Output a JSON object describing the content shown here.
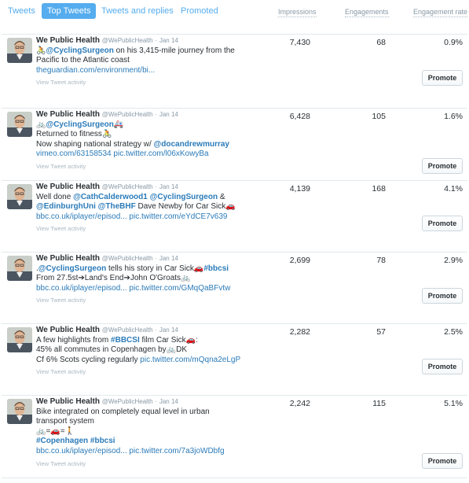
{
  "tabs": [
    {
      "label": "Tweets",
      "active": false
    },
    {
      "label": "Top Tweets",
      "active": true
    },
    {
      "label": "Tweets and replies",
      "active": false
    },
    {
      "label": "Promoted",
      "active": false
    }
  ],
  "columns": {
    "impressions": "Impressions",
    "engagements": "Engagements",
    "engagement_rate": "Engagement rate"
  },
  "activity_label": "View Tweet activity",
  "promote_label": "Promote",
  "tweets": [
    {
      "name": "We Public Health",
      "handle": "@WePublicHealth",
      "sep": "·",
      "date": "Jan 14",
      "lines": [
        [
          {
            "t": "🚴",
            "k": "text"
          },
          {
            "t": "@CyclingSurgeon",
            "k": "mention"
          },
          {
            "t": " on his 3,415-mile journey from the",
            "k": "text"
          }
        ],
        [
          {
            "t": "Pacific to the Atlantic coast",
            "k": "text"
          }
        ],
        [
          {
            "t": "theguardian.com/environment/bi...",
            "k": "link"
          }
        ]
      ],
      "impressions": "7,430",
      "engagements": "68",
      "engagement_rate": "0.9%"
    },
    {
      "name": "We Public Health",
      "handle": "@WePublicHealth",
      "sep": "·",
      "date": "Jan 14",
      "lines": [
        [
          {
            "t": "🚲",
            "k": "text"
          },
          {
            "t": "@CyclingSurgeon",
            "k": "mention"
          },
          {
            "t": "🚑",
            "k": "text"
          }
        ],
        [
          {
            "t": "Returned to fitness",
            "k": "text"
          },
          {
            "t": "🚴",
            "k": "text"
          }
        ],
        [
          {
            "t": "Now shaping national strategy w/ ",
            "k": "text"
          },
          {
            "t": "@docandrewmurray",
            "k": "mention"
          }
        ],
        [
          {
            "t": "vimeo.com/63158534",
            "k": "link"
          },
          {
            "t": " ",
            "k": "text"
          },
          {
            "t": "pic.twitter.com/l06xKowyBa",
            "k": "link"
          }
        ]
      ],
      "impressions": "6,428",
      "engagements": "105",
      "engagement_rate": "1.6%"
    },
    {
      "name": "We Public Health",
      "handle": "@WePublicHealth",
      "sep": "·",
      "date": "Jan 14",
      "lines": [
        [
          {
            "t": "Well done ",
            "k": "text"
          },
          {
            "t": "@CathCalderwood1",
            "k": "mention"
          },
          {
            "t": " ",
            "k": "text"
          },
          {
            "t": "@CyclingSurgeon",
            "k": "mention"
          },
          {
            "t": " &",
            "k": "text"
          }
        ],
        [
          {
            "t": "@EdinburghUni",
            "k": "mention"
          },
          {
            "t": " ",
            "k": "text"
          },
          {
            "t": "@TheBHF",
            "k": "mention"
          },
          {
            "t": " Dave Newby for Car Sick",
            "k": "text"
          },
          {
            "t": "🚗",
            "k": "text"
          }
        ],
        [
          {
            "t": "bbc.co.uk/iplayer/episod...",
            "k": "link"
          },
          {
            "t": " ",
            "k": "text"
          },
          {
            "t": "pic.twitter.com/eYdCE7v639",
            "k": "link"
          }
        ]
      ],
      "impressions": "4,139",
      "engagements": "168",
      "engagement_rate": "4.1%"
    },
    {
      "name": "We Public Health",
      "handle": "@WePublicHealth",
      "sep": "·",
      "date": "Jan 14",
      "lines": [
        [
          {
            "t": ".",
            "k": "text"
          },
          {
            "t": "@CyclingSurgeon",
            "k": "mention"
          },
          {
            "t": " tells his story in Car Sick",
            "k": "text"
          },
          {
            "t": "🚗",
            "k": "text"
          },
          {
            "t": "#bbcsi",
            "k": "mention"
          }
        ],
        [
          {
            "t": "From 27.5st",
            "k": "text"
          },
          {
            "t": "➔",
            "k": "text"
          },
          {
            "t": "Land's End",
            "k": "text"
          },
          {
            "t": "➔",
            "k": "text"
          },
          {
            "t": "John O'Groats",
            "k": "text"
          },
          {
            "t": "🚲",
            "k": "text"
          }
        ],
        [
          {
            "t": "bbc.co.uk/iplayer/episod...",
            "k": "link"
          },
          {
            "t": " ",
            "k": "text"
          },
          {
            "t": "pic.twitter.com/GMqQaBFvtw",
            "k": "link"
          }
        ]
      ],
      "impressions": "2,699",
      "engagements": "78",
      "engagement_rate": "2.9%"
    },
    {
      "name": "We Public Health",
      "handle": "@WePublicHealth",
      "sep": "·",
      "date": "Jan 14",
      "lines": [
        [
          {
            "t": "A few highlights from ",
            "k": "text"
          },
          {
            "t": "#BBCSI",
            "k": "mention"
          },
          {
            "t": " film Car Sick",
            "k": "text"
          },
          {
            "t": "🚗",
            "k": "text"
          },
          {
            "t": ":",
            "k": "text"
          }
        ],
        [
          {
            "t": "45% all commutes in Copenhagen by",
            "k": "text"
          },
          {
            "t": "🚲",
            "k": "text"
          },
          {
            "t": "DK",
            "k": "text"
          }
        ],
        [
          {
            "t": "Cf 6% Scots cycling regularly ",
            "k": "text"
          },
          {
            "t": "pic.twitter.com/mQqna2eLgP",
            "k": "link"
          }
        ]
      ],
      "impressions": "2,282",
      "engagements": "57",
      "engagement_rate": "2.5%"
    },
    {
      "name": "We Public Health",
      "handle": "@WePublicHealth",
      "sep": "·",
      "date": "Jan 14",
      "lines": [
        [
          {
            "t": "Bike integrated on completely equal level in urban",
            "k": "text"
          }
        ],
        [
          {
            "t": "transport system",
            "k": "text"
          }
        ],
        [
          {
            "t": "🚲",
            "k": "text"
          },
          {
            "t": "=",
            "k": "text"
          },
          {
            "t": "🚗",
            "k": "text"
          },
          {
            "t": "=",
            "k": "text"
          },
          {
            "t": "🚶",
            "k": "text"
          }
        ],
        [
          {
            "t": "#Copenhagen",
            "k": "mention"
          },
          {
            "t": " ",
            "k": "text"
          },
          {
            "t": "#bbcsi",
            "k": "mention"
          }
        ],
        [
          {
            "t": "bbc.co.uk/iplayer/episod...",
            "k": "link"
          },
          {
            "t": " ",
            "k": "text"
          },
          {
            "t": "pic.twitter.com/7a3joWDbfg",
            "k": "link"
          }
        ]
      ],
      "impressions": "2,242",
      "engagements": "115",
      "engagement_rate": "5.1%"
    }
  ]
}
